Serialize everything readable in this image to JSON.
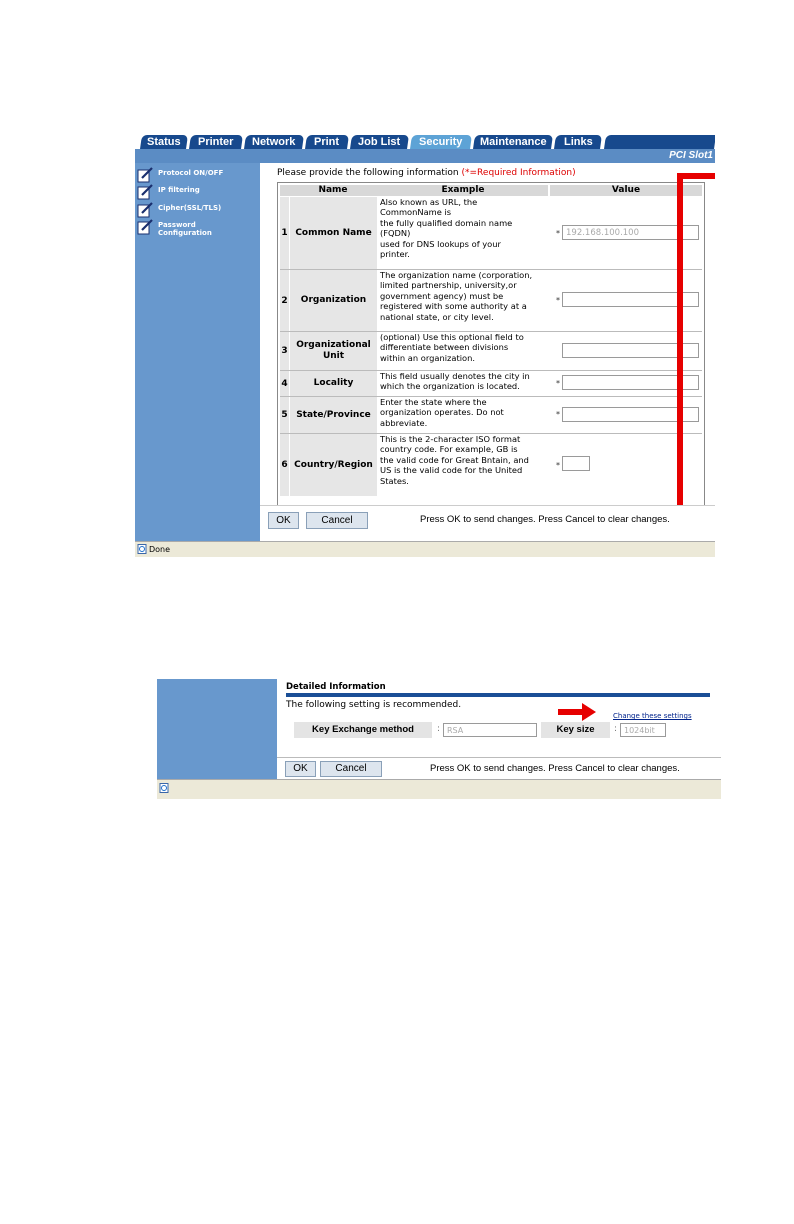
{
  "tabs": [
    {
      "label": "Status"
    },
    {
      "label": "Printer"
    },
    {
      "label": "Network"
    },
    {
      "label": "Print"
    },
    {
      "label": "Job List"
    },
    {
      "label": "Security"
    },
    {
      "label": "Maintenance"
    },
    {
      "label": "Links"
    }
  ],
  "active_tab": "Security",
  "slot_label": "PCI Slot1",
  "sidebar": {
    "items": [
      {
        "label": "Protocol ON/OFF"
      },
      {
        "label": "IP filtering"
      },
      {
        "label": "Cipher(SSL/TLS)"
      },
      {
        "label": "Password\nConfiguration"
      }
    ]
  },
  "form": {
    "intro": "Please provide the following information",
    "required_note": "(*=Required Information)",
    "headers": {
      "name": "Name",
      "example": "Example",
      "value": "Value"
    },
    "rows": [
      {
        "num": "1",
        "name": "Common Name",
        "example": "Also known as URL, the\nCommonName is\nthe fully qualified domain name\n(FQDN)\nused for DNS lookups of your\nprinter.",
        "required": "*",
        "value": "192.168.100.100"
      },
      {
        "num": "2",
        "name": "Organization",
        "example": "The organization name (corporation,\nlimited partnership, university,or\ngovernment agency) must be\nregistered with some authority at a\nnational state, or city level.",
        "required": "*",
        "value": ""
      },
      {
        "num": "3",
        "name": "Organizational\nUnit",
        "example": "(optional) Use this optional field to\ndifferentiate between divisions\nwithin an organization.",
        "required": "",
        "value": ""
      },
      {
        "num": "4",
        "name": "Locality",
        "example": "This field usually denotes the city in\nwhich the organization is located.",
        "required": "*",
        "value": ""
      },
      {
        "num": "5",
        "name": "State/Province",
        "example": "Enter the state where the\norganization operates. Do not\nabbreviate.",
        "required": "*",
        "value": ""
      },
      {
        "num": "6",
        "name": "Country/Region",
        "example": "This is the 2-character ISO format\ncountry code. For example, GB is\nthe valid code for Great Bntain, and\nUS is the valid code for the United\nStates.",
        "required": "*",
        "value": ""
      }
    ]
  },
  "buttons": {
    "ok": "OK",
    "cancel": "Cancel"
  },
  "footer_message": "Press OK to send changes. Press Cancel to clear changes.",
  "status_text": "Done",
  "detail": {
    "title": "Detailed Information",
    "recommend": "The following setting is recommended.",
    "change_link": "Change these settings",
    "key_exchange_label": "Key Exchange method",
    "key_exchange_value": "RSA",
    "key_size_label": "Key size",
    "key_size_value": "1024bit",
    "colon": ":"
  },
  "colors": {
    "tab_bg": "#17498d",
    "tab_active": "#5da3d6",
    "sidebar": "#6898cd",
    "highlight": "#e60000"
  }
}
